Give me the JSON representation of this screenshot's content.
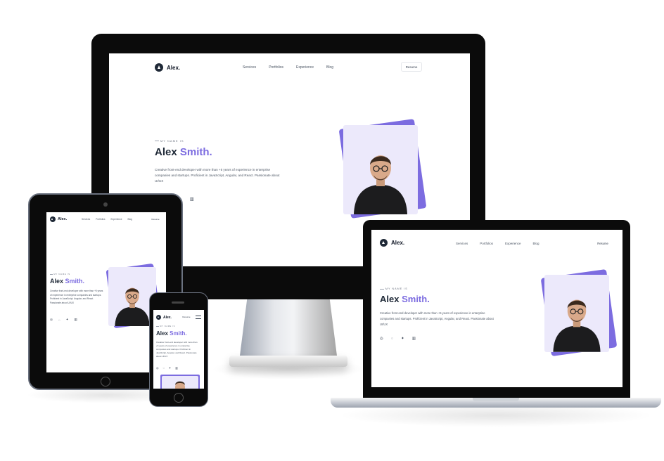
{
  "site": {
    "logo": "Alex.",
    "nav": [
      "Services",
      "Portfolios",
      "Experience",
      "Blog"
    ],
    "resume": "Resume",
    "eyebrow": "MY NAME IS",
    "first_name": "Alex",
    "last_name": "Smith.",
    "desc_long": "Creative front-end developer with more than +5 years of experience in enterprise companies and startups. Proficient in JavaScript, Angular, and React. Passionate about UI/UX",
    "desc_short": "Creative front-end developer with more than +5 years of experience in enterprise companies and startups. Proficient in JavaScript, Angular, and React. Passionate about UI/UX",
    "socials": [
      "instagram-icon",
      "chat-icon",
      "twitter-icon",
      "linkedin-icon"
    ]
  },
  "colors": {
    "accent": "#7c6ce0",
    "card": "#ece9fb",
    "dark": "#1f2937",
    "frame": "#0b0b0b"
  }
}
